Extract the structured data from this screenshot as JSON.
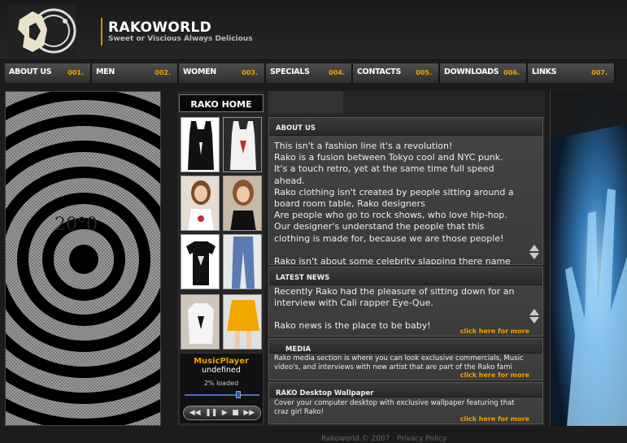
{
  "header": {
    "title": "RAKOWORLD",
    "tagline": "Sweet or Viscious Always Delicious"
  },
  "nav": [
    {
      "label": "ABOUT US",
      "num": "001."
    },
    {
      "label": "MEN",
      "num": "002."
    },
    {
      "label": "WOMEN",
      "num": "003."
    },
    {
      "label": "SPECIALS",
      "num": "004."
    },
    {
      "label": "CONTACTS",
      "num": "005."
    },
    {
      "label": "DOWNLOADS",
      "num": "006."
    },
    {
      "label": "LINKS",
      "num": "007."
    }
  ],
  "left_panel": {
    "decor_text": "20°0"
  },
  "mid": {
    "home_label": "RAKO HOME",
    "player": {
      "title": "MusicPlayer",
      "status": "undefined",
      "loaded": "2% loaded",
      "progress_percent": 2,
      "volume_fraction": 0.72
    }
  },
  "about": {
    "heading": "ABOUT US",
    "lines": [
      "This isn't a fashion line it's a revolution!",
      "Rako is a fusion between Tokyo cool and NYC punk.",
      "It's a touch retro, yet at the same time full speed ahead.",
      "Rako clothing isn't created by people sitting around a board room table, Rako designers",
      "Are people who go to rock shows, who love hip-hop. Our designer's understand the people that this clothing is made for, because we are those people!",
      "",
      "Rako isn't about some celebrity slapping there name on a"
    ]
  },
  "news": {
    "heading": "LATEST NEWS",
    "lines": [
      "Recently Rako had the pleasure of sitting down for an interview with Cali rapper Eye-Que.",
      "",
      "Rako news is the place to be baby!"
    ],
    "more": "click here for more"
  },
  "media": {
    "heading": "MEDIA",
    "text": "Rako media section is where you can look exclusive commercials, Music video's, and interviews with new artist that are part of the Rako fami",
    "more": "click here for more"
  },
  "wallpaper": {
    "heading": "RAKO Desktop Wallpaper",
    "text": "Cover your computer desktop with exclusive wallpaper featuring that craz girl Rako!",
    "more": "click here for more"
  },
  "footer": {
    "text": "Rakoworld  © 2007  ·  Privacy Policy"
  },
  "colors": {
    "accent": "#f0a000",
    "background": "#1c1c1c"
  }
}
